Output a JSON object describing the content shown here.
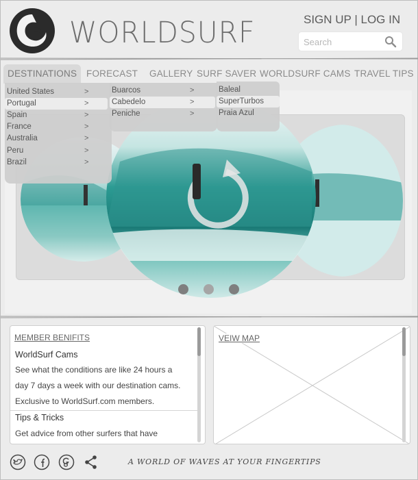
{
  "header": {
    "brand": "WORLDSURF",
    "sign_up": "SIGN UP",
    "separator": "|",
    "log_in": "LOG IN",
    "search_placeholder": "Search"
  },
  "nav": {
    "tabs": [
      {
        "label": "DESTINATIONS",
        "active": true
      },
      {
        "label": "FORECAST"
      },
      {
        "label": "GALLERY"
      },
      {
        "label": "SURF SAVER"
      },
      {
        "label": "WORLDSURF CAMS"
      },
      {
        "label": "TRAVEL TIPS"
      }
    ]
  },
  "dropdown": {
    "countries": [
      "United States",
      "Portugal",
      "Spain",
      "France",
      "Australia",
      "Peru",
      "Brazil"
    ],
    "selected_country": "Portugal",
    "regions": [
      "Buarcos",
      "Cabedelo",
      "Peniche"
    ],
    "selected_region": "Cabedelo",
    "spots": [
      "Baleal",
      "SuperTurbos",
      "Praia Azul"
    ],
    "selected_spot": "SuperTurbos",
    "chevron": ">"
  },
  "carousel": {
    "slides": 3,
    "active_index": 0
  },
  "member_panel": {
    "heading": "MEMBER BENIFITS",
    "sections": [
      {
        "title": "WorldSurf Cams",
        "lines": [
          "See what the conditions are like 24 hours a",
          "day 7 days a week with our destination cams.",
          "Exclusive to WorldSurf.com members."
        ]
      },
      {
        "title": "Tips & Tricks",
        "lines": [
          "Get advice from other surfers that have"
        ]
      }
    ]
  },
  "map_panel": {
    "heading": "VEIW MAP"
  },
  "footer": {
    "tagline": "A WORLD OF WAVES AT YOUR FINGERTIPS",
    "social": [
      "twitter-icon",
      "facebook-icon",
      "google-plus-icon",
      "share-icon"
    ]
  },
  "colors": {
    "background": "#ececec",
    "accent_gray": "#6d6d6d",
    "water": "#3aa9a8"
  }
}
